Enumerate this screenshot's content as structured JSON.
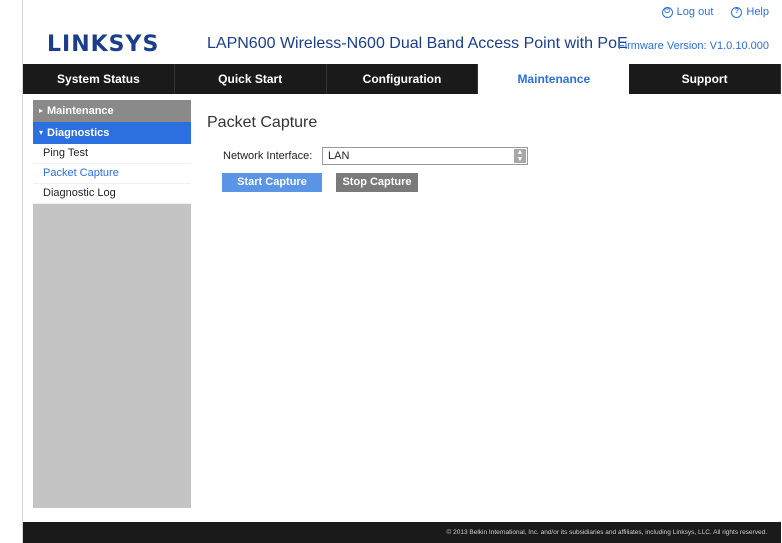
{
  "header": {
    "logo": "LINKSYS",
    "product_title": "LAPN600 Wireless-N600 Dual Band Access Point with PoE",
    "logout_label": "Log out",
    "help_label": "Help",
    "firmware": "Firmware Version: V1.0.10.000"
  },
  "nav": {
    "tabs": [
      {
        "label": "System Status"
      },
      {
        "label": "Quick Start"
      },
      {
        "label": "Configuration"
      },
      {
        "label": "Maintenance"
      },
      {
        "label": "Support"
      }
    ],
    "active": "Maintenance"
  },
  "sidebar": {
    "sections": [
      {
        "label": "Maintenance"
      },
      {
        "label": "Diagnostics"
      }
    ],
    "items": [
      {
        "label": "Ping Test"
      },
      {
        "label": "Packet Capture"
      },
      {
        "label": "Diagnostic Log"
      }
    ]
  },
  "main": {
    "title": "Packet Capture",
    "network_interface_label": "Network Interface:",
    "network_interface_value": "LAN",
    "start_button": "Start Capture",
    "stop_button": "Stop Capture"
  },
  "footer": {
    "text": "© 2013 Belkin International, Inc. and/or its subsidiaries and affiliates, including Linksys, LLC. All rights reserved."
  },
  "colors": {
    "accent": "#2b6fe0",
    "brand": "#1a3e8c",
    "nav_bg": "#1a1a1a"
  }
}
